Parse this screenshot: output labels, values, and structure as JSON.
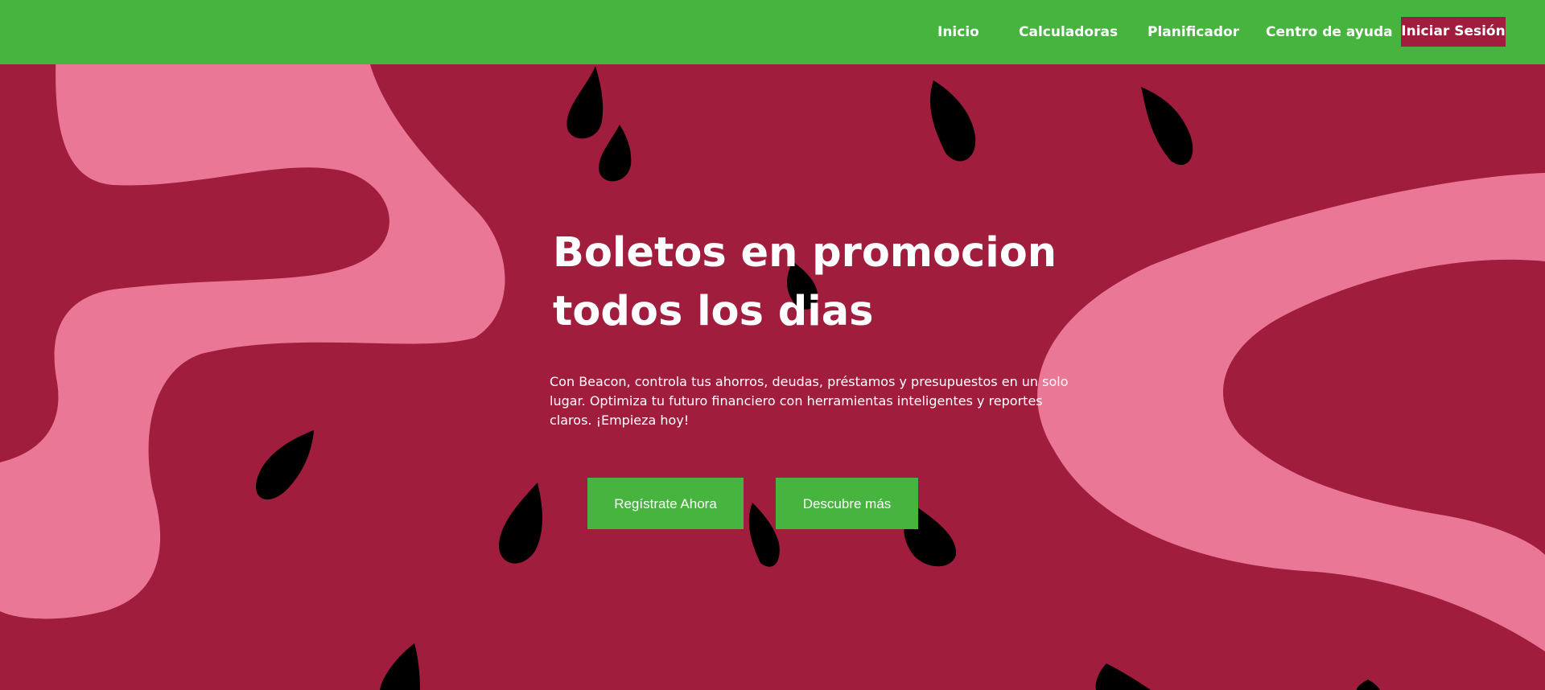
{
  "nav": {
    "items": [
      {
        "label": "Inicio"
      },
      {
        "label": "Calculadoras"
      },
      {
        "label": "Planificador"
      },
      {
        "label": "Centro de ayuda"
      }
    ],
    "login_label": "Iniciar Sesión"
  },
  "hero": {
    "title": "Boletos en promocion todos los dias",
    "description": "Con Beacon, controla tus ahorros, deudas, préstamos y presupuestos en un solo lugar. Optimiza tu futuro financiero con herramientas inteligentes y reportes claros. ¡Empieza hoy!",
    "primary_cta": "Regístrate Ahora",
    "secondary_cta": "Descubre más"
  },
  "colors": {
    "nav_green": "#46b43f",
    "watermelon_red": "#a01d3d",
    "rind_pink": "#e97795",
    "seed_black": "#000000"
  }
}
